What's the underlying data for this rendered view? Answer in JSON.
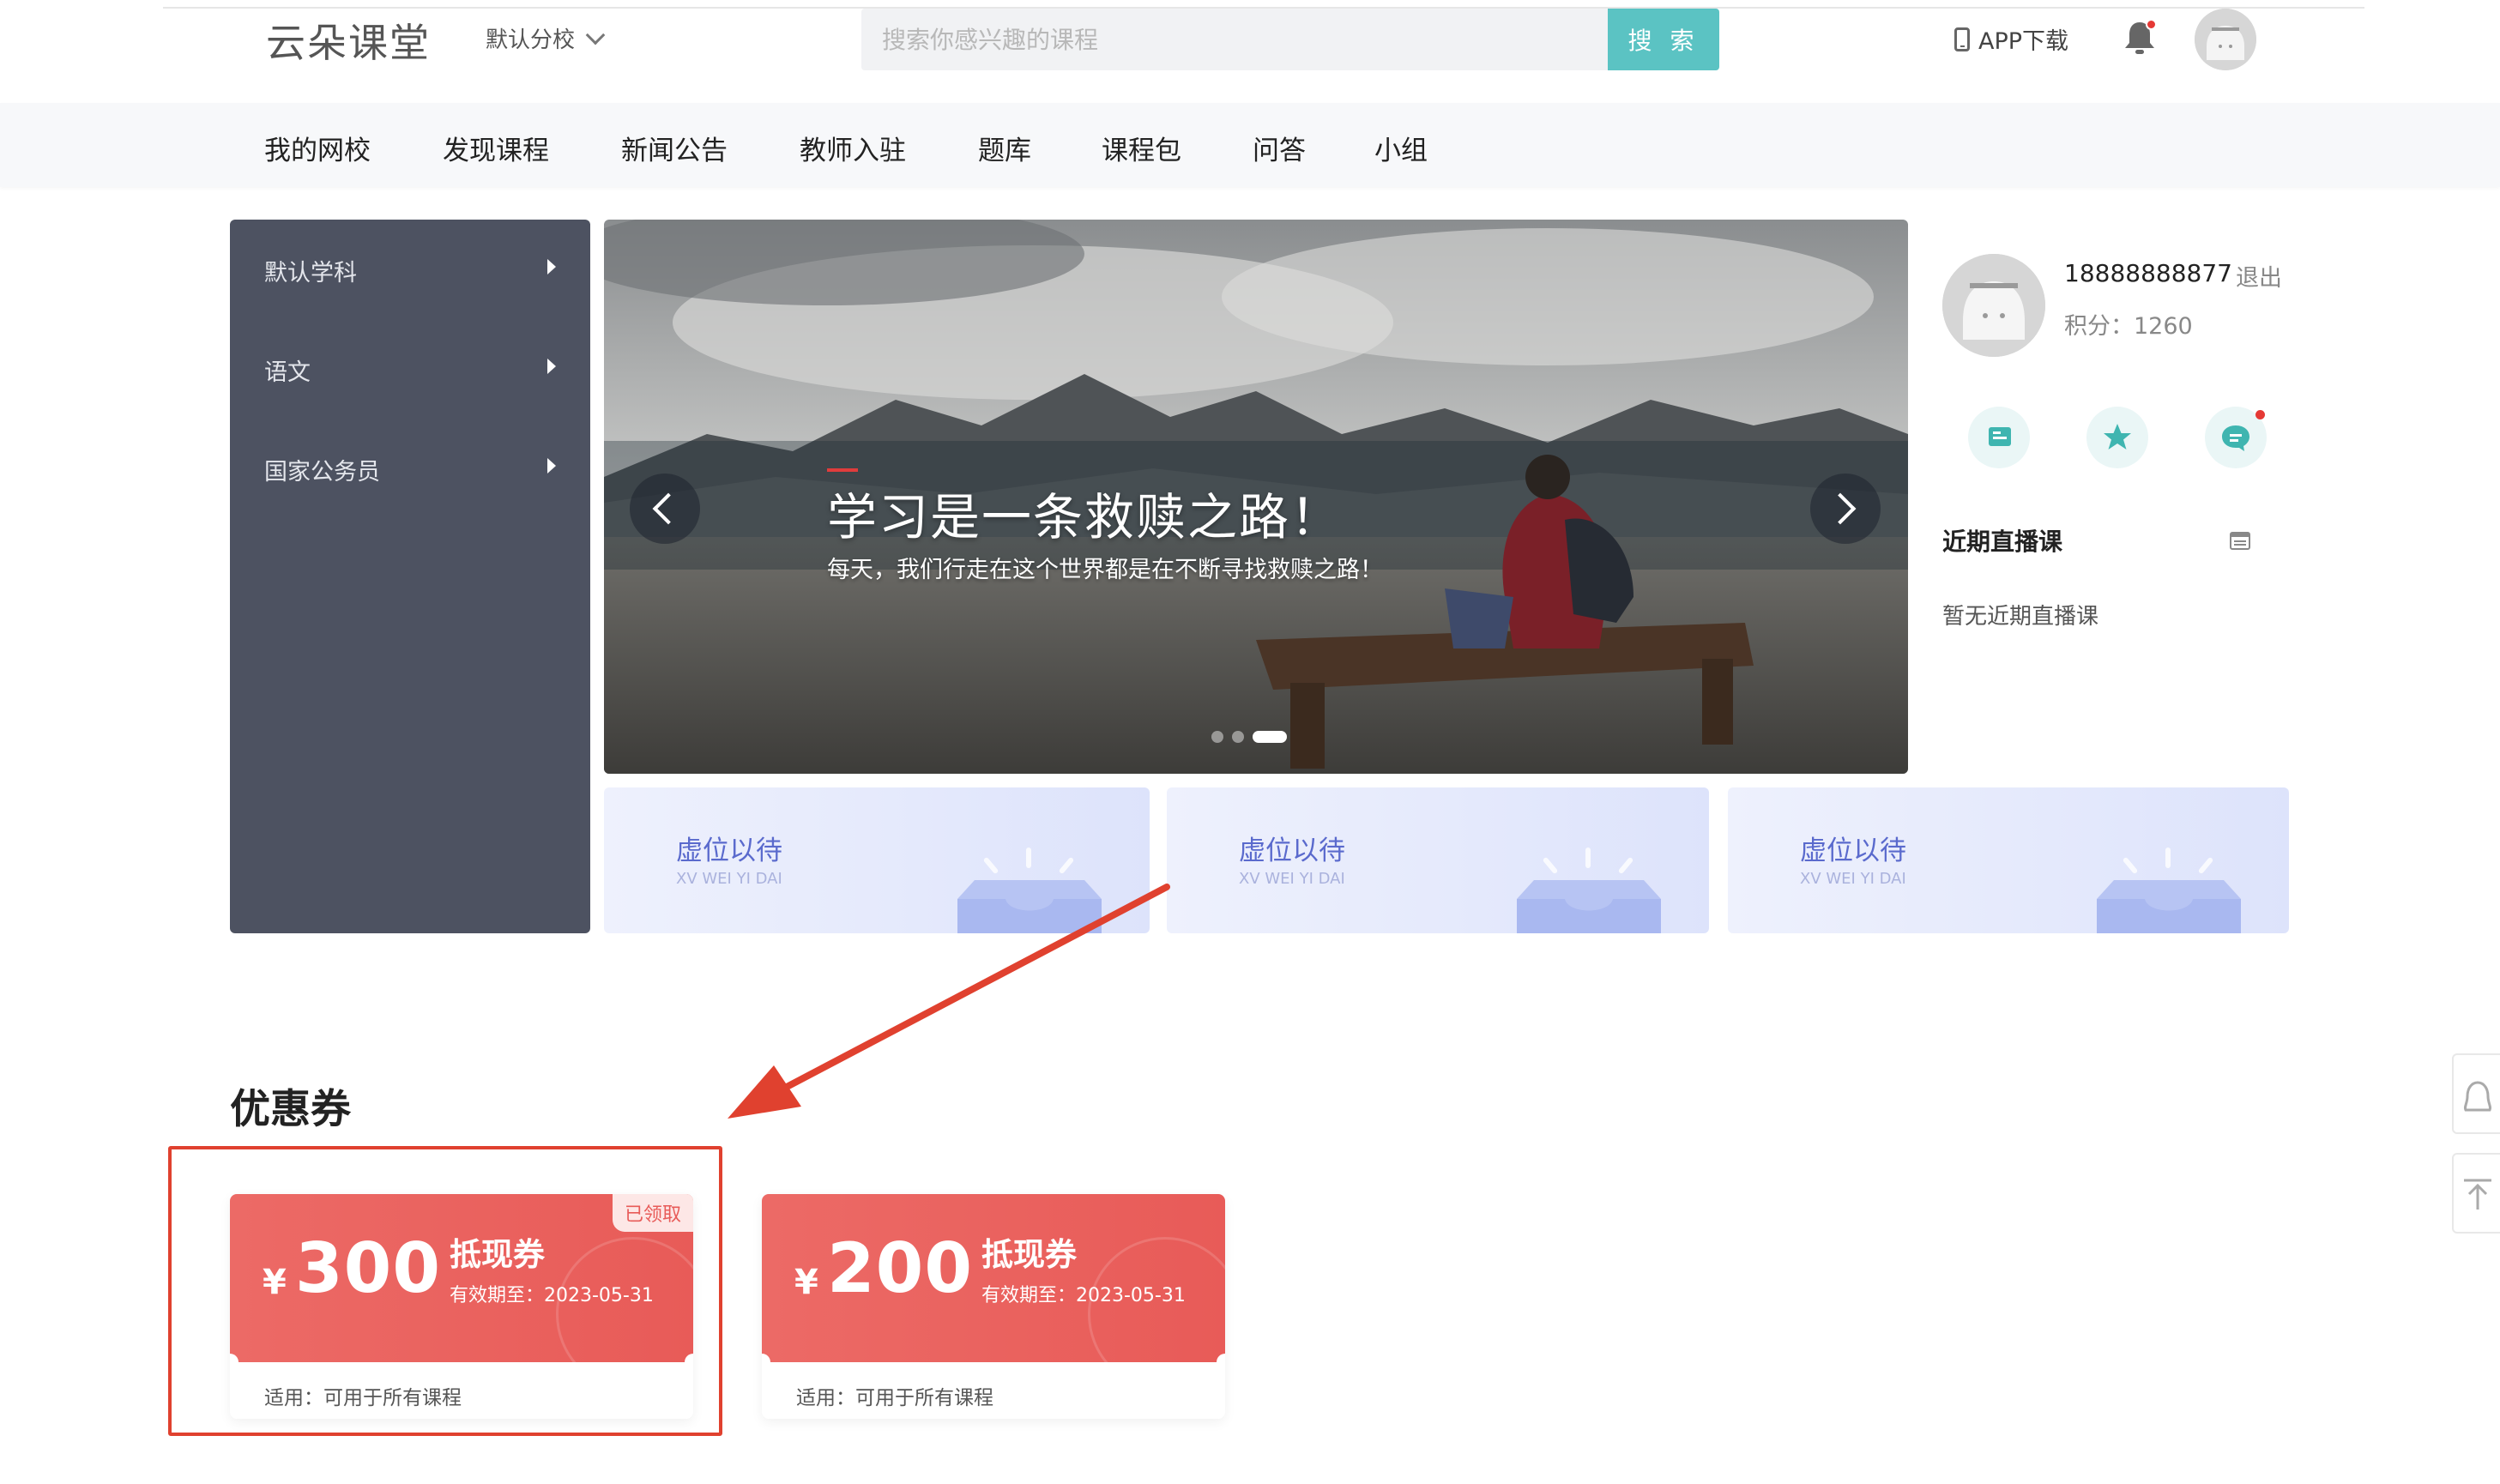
{
  "header": {
    "logo": "云朵课堂",
    "branch": "默认分校",
    "search_placeholder": "搜索你感兴趣的课程",
    "search_button": "搜 索",
    "app_download": "APP下载"
  },
  "nav": {
    "items": [
      "我的网校",
      "发现课程",
      "新闻公告",
      "教师入驻",
      "题库",
      "课程包",
      "问答",
      "小组"
    ]
  },
  "categories": [
    "默认学科",
    "语文",
    "国家公务员"
  ],
  "banner": {
    "title": "学习是一条救赎之路！",
    "subtitle": "每天，我们行走在这个世界都是在不断寻找救赎之路！",
    "active_slide": 3,
    "slide_count": 3
  },
  "placeholders": [
    {
      "title": "虚位以待",
      "subtitle": "XV WEI YI DAI"
    },
    {
      "title": "虚位以待",
      "subtitle": "XV WEI YI DAI"
    },
    {
      "title": "虚位以待",
      "subtitle": "XV WEI YI DAI"
    }
  ],
  "profile": {
    "phone": "18888888877",
    "logout": "退出",
    "points_label": "积分：",
    "points": "1260",
    "quick_icons": [
      "notebook-icon",
      "star-icon",
      "chat-icon"
    ],
    "live_title": "近期直播课",
    "live_empty": "暂无近期直播课"
  },
  "coupons": {
    "section_title": "优惠券",
    "items": [
      {
        "symbol": "¥",
        "amount": "300",
        "type": "抵现券",
        "expiry": "有效期至：2023-05-31",
        "usage": "适用：可用于所有课程",
        "badge": "已领取"
      },
      {
        "symbol": "¥",
        "amount": "200",
        "type": "抵现券",
        "expiry": "有效期至：2023-05-31",
        "usage": "适用：可用于所有课程",
        "badge": ""
      }
    ]
  },
  "colors": {
    "accent": "#5bc3c3",
    "coupon_red": "#e85b58",
    "menu_bg": "#4d5261",
    "annotation_red": "#e0412f"
  }
}
